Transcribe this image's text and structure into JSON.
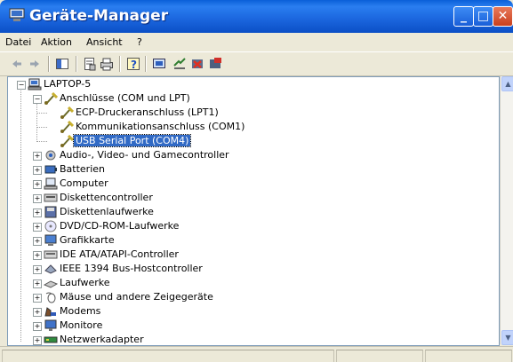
{
  "window": {
    "title": "Geräte-Manager",
    "controls": {
      "minimize": "_",
      "maximize": "□",
      "close": "✕"
    }
  },
  "menu": {
    "items": [
      {
        "label": "Datei"
      },
      {
        "label": "Aktion"
      },
      {
        "label": "Ansicht"
      },
      {
        "label": "?"
      }
    ]
  },
  "toolbar": {
    "icons": [
      "back-icon",
      "forward-icon",
      "show-hide-tree-icon",
      "properties-icon",
      "print-icon",
      "help-icon",
      "scan-hardware-icon",
      "update-driver-icon",
      "disable-device-icon",
      "uninstall-device-icon"
    ]
  },
  "tree": {
    "root": "LAPTOP-5",
    "ports_category": "Anschlüsse (COM und LPT)",
    "ports": [
      "ECP-Druckeranschluss (LPT1)",
      "Kommunikationsanschluss (COM1)",
      "USB Serial Port (COM4)"
    ],
    "categories": [
      "Audio-, Video- und Gamecontroller",
      "Batterien",
      "Computer",
      "Diskettencontroller",
      "Diskettenlaufwerke",
      "DVD/CD-ROM-Laufwerke",
      "Grafikkarte",
      "IDE ATA/ATAPI-Controller",
      "IEEE 1394 Bus-Hostcontroller",
      "Laufwerke",
      "Mäuse und andere Zeigegeräte",
      "Modems",
      "Monitore",
      "Netzwerkadapter"
    ]
  },
  "colors": {
    "title_bar": "#0a5fd8",
    "selection": "#316ac5",
    "window_face": "#ece9d8"
  }
}
